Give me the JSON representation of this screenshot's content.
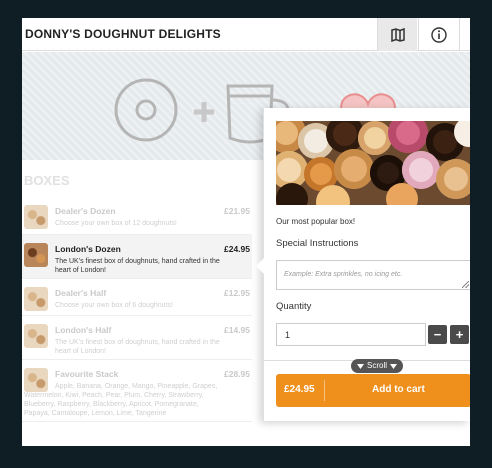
{
  "header": {
    "title": "DONNY'S DOUGHNUT DELIGHTS",
    "menu_icon": "map-icon",
    "info_icon": "info-icon"
  },
  "hero": {
    "icons": [
      "doughnut-icon",
      "plus-icon",
      "coffee-mug-icon",
      "minus-icon",
      "heart-icon"
    ]
  },
  "section": {
    "title": "BOXES"
  },
  "items": [
    {
      "name": "Dealer's Dozen",
      "price": "£21.95",
      "desc": "Choose your own box of 12 doughnuts!"
    },
    {
      "name": "London's Dozen",
      "price": "£24.95",
      "desc": "The UK's finest box of doughnuts, hand crafted in the heart of London!"
    },
    {
      "name": "Dealer's Half",
      "price": "£12.95",
      "desc": "Choose your own box of 6 doughnuts!"
    },
    {
      "name": "London's Half",
      "price": "£14.95",
      "desc": "The UK's finest box of doughnuts, hand crafted in the heart of London!"
    },
    {
      "name": "Favourite Stack",
      "price": "£28.95",
      "desc": "Apple, Banana, Orange, Mango, Pineapple, Grapes, Watermelon, Kiwi, Peach, Pear, Plum, Cherry, Strawberry, Blueberry, Raspberry, Blackberry, Apricot, Pomegranate, Papaya, Cantaloupe, Lemon, Lime, Tangerine"
    }
  ],
  "popup": {
    "tagline": "Our most popular box!",
    "instructions_label": "Special Instructions",
    "instructions_placeholder": "Example: Extra sprinkles, no icing etc.",
    "quantity_label": "Quantity",
    "quantity_value": "1",
    "minus_label": "−",
    "plus_label": "+",
    "cart_price": "£24.95",
    "cart_label": "Add to cart"
  },
  "scroll_label": "Scroll",
  "colors": {
    "accent": "#f0901c",
    "background": "#0f1e24",
    "stepper": "#4a4a4a"
  }
}
